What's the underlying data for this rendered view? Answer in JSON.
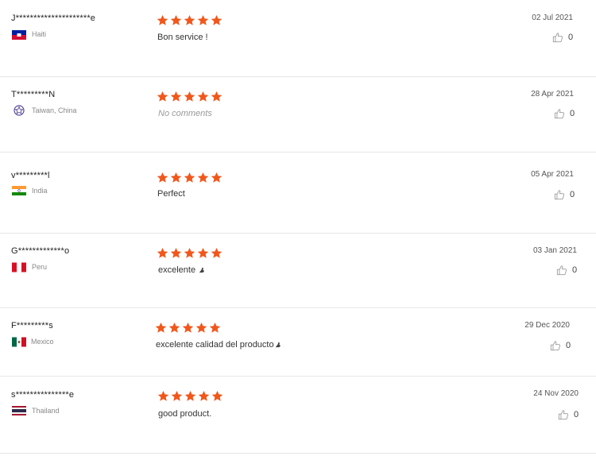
{
  "colors": {
    "star": "#f1571b",
    "divider": "#e6e6e6"
  },
  "reviews": [
    {
      "name": "J*********************e",
      "country": "Haiti",
      "flag": "haiti-flag",
      "stars": 5,
      "comment": "Bon service !",
      "date": "02 Jul 2021",
      "likes": "0"
    },
    {
      "name": "T*********N",
      "country": "Taiwan, China",
      "flag": "taiwan-flag",
      "stars": 5,
      "comment": "No comments",
      "date": "28 Apr 2021",
      "likes": "0"
    },
    {
      "name": "v*********l",
      "country": "India",
      "flag": "india-flag",
      "stars": 5,
      "comment": "Perfect",
      "date": "05 Apr 2021",
      "likes": "0"
    },
    {
      "name": "G*************o",
      "country": "Peru",
      "flag": "peru-flag",
      "stars": 5,
      "comment": "excelente",
      "date": "03 Jan 2021",
      "likes": "0"
    },
    {
      "name": "F*********s",
      "country": "Mexico",
      "flag": "mexico-flag",
      "stars": 5,
      "comment": "excelente calidad del producto",
      "date": "29 Dec 2020",
      "likes": "0"
    },
    {
      "name": "s***************e",
      "country": "Thailand",
      "flag": "thailand-flag",
      "stars": 5,
      "comment": "good product.",
      "date": "24 Nov 2020",
      "likes": "0"
    }
  ]
}
